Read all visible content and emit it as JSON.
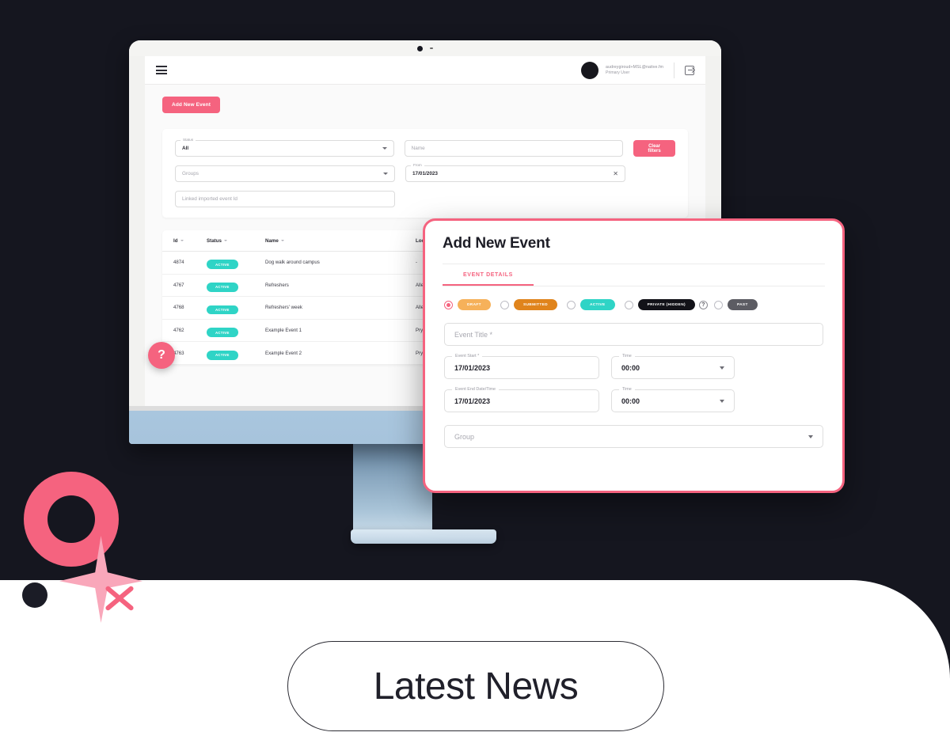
{
  "app": {
    "topbar": {
      "menu_icon": "hamburger-icon",
      "user_email": "audreygiroud+MSL@native.fm",
      "user_role": "Primary User",
      "logout_icon": "logout-icon"
    },
    "add_new_event_label": "Add New Event",
    "filters": {
      "status_legend": "Status",
      "status_value": "All",
      "name_placeholder": "Name",
      "clear_filters_label": "Clear filters",
      "groups_placeholder": "Groups",
      "from_legend": "From",
      "from_value": "17/01/2023",
      "linked_placeholder": "Linked imported event Id"
    },
    "table": {
      "columns": [
        "Id",
        "Status",
        "Name",
        "Location"
      ],
      "rows": [
        {
          "id": "4874",
          "status": "ACTIVE",
          "name": "Dog walk around campus",
          "location": "-"
        },
        {
          "id": "4767",
          "status": "ACTIVE",
          "name": "Refreshers",
          "location": "Alley Cafe"
        },
        {
          "id": "4768",
          "status": "ACTIVE",
          "name": "Refreshers' week",
          "location": "Alley Cafe"
        },
        {
          "id": "4762",
          "status": "ACTIVE",
          "name": "Example Event 1",
          "location": "Pryzm Brighton"
        },
        {
          "id": "4763",
          "status": "ACTIVE",
          "name": "Example Event 2",
          "location": "Pryzm Brighton"
        }
      ]
    },
    "help_bubble_label": "?"
  },
  "modal": {
    "title": "Add New Event",
    "tab_label": "EVENT DETAILS",
    "status_options": [
      {
        "label": "DRAFT",
        "selected": true
      },
      {
        "label": "SUBMITTED",
        "selected": false
      },
      {
        "label": "ACTIVE",
        "selected": false
      },
      {
        "label": "PRIVATE (HIDDEN)",
        "selected": false
      },
      {
        "label": "PAST",
        "selected": false
      }
    ],
    "help_icon_label": "?",
    "event_title_placeholder": "Event Title *",
    "event_start_legend": "Event Start *",
    "event_start_value": "17/01/2023",
    "event_start_time_legend": "Time",
    "event_start_time_value": "00:00",
    "event_end_legend": "Event End Date/Time",
    "event_end_value": "17/01/2023",
    "event_end_time_legend": "Time",
    "event_end_time_value": "00:00",
    "group_placeholder": "Group"
  },
  "footer": {
    "latest_news_label": "Latest News"
  },
  "colors": {
    "background": "#15161f",
    "accent_pink": "#f5637f",
    "teal": "#2fd4c6",
    "amber": "#f6b15a",
    "orange": "#e0841c",
    "gray_pill": "#5c5c63",
    "black_pill": "#121218",
    "monitor_chin": "#a9c6de"
  }
}
